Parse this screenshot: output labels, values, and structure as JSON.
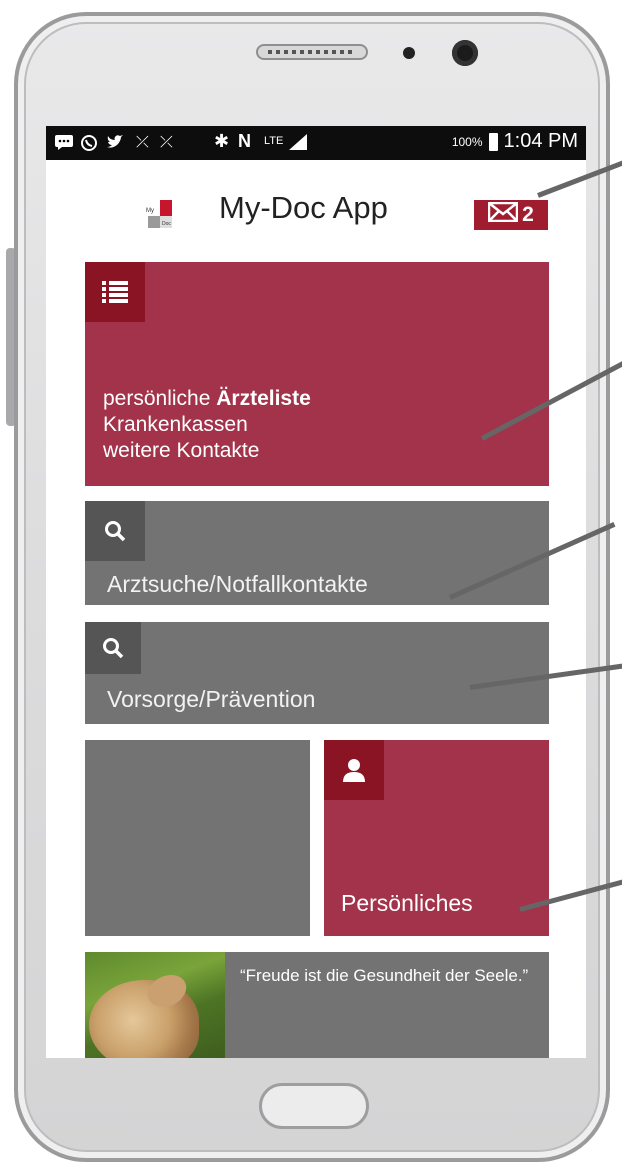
{
  "status_bar": {
    "battery": "100%",
    "time": "1:04 PM",
    "network": "LTE"
  },
  "app": {
    "title": "My-Doc App",
    "logo_text": "My Doc",
    "mail_count": "2"
  },
  "tiles": {
    "aerzteliste": {
      "line1_prefix": "persönliche ",
      "line1_bold": "Ärzteliste",
      "line2": "Krankenkassen",
      "line3": "weitere Kontakte"
    },
    "arztsuche": {
      "label": "Arztsuche/Notfallkontakte"
    },
    "vorsorge": {
      "label": "Vorsorge/Prävention"
    },
    "persoenliches": {
      "label": "Persönliches"
    },
    "quote": {
      "text": "“Freude ist die Gesundheit der Seele.”"
    }
  },
  "colors": {
    "accent_red": "#a3334a",
    "dark_red": "#8a1424",
    "grey_tile": "#737373"
  },
  "icons": [
    "list-icon",
    "search-icon",
    "user-icon",
    "mail-icon",
    "whatsapp-icon",
    "twitter-icon",
    "bluetooth-icon",
    "battery-icon"
  ]
}
